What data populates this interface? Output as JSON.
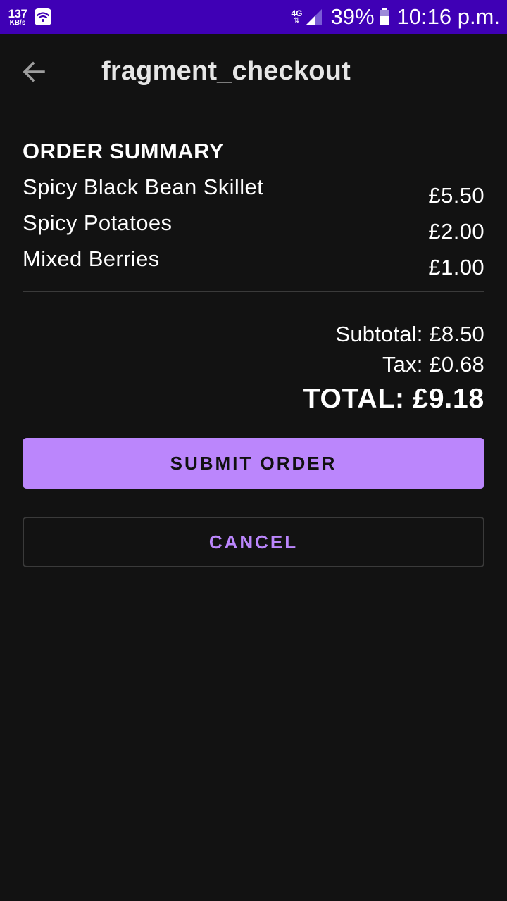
{
  "status_bar": {
    "net_speed_value": "137",
    "net_speed_unit": "KB/s",
    "network_type": "4G",
    "network_arrows": "⇅",
    "battery_percent": "39%",
    "time": "10:16 p.m.",
    "icons": [
      "wifi-icon",
      "signal-icon",
      "battery-icon"
    ]
  },
  "app_bar": {
    "title": "fragment_checkout",
    "back_icon": "arrow-left-icon"
  },
  "order_summary": {
    "heading": "ORDER SUMMARY",
    "items": [
      {
        "name": "Spicy Black Bean Skillet",
        "price": "£5.50"
      },
      {
        "name": "Spicy Potatoes",
        "price": "£2.00"
      },
      {
        "name": "Mixed Berries",
        "price": "£1.00"
      }
    ],
    "subtotal": "Subtotal: £8.50",
    "tax": "Tax: £0.68",
    "total": "TOTAL: £9.18"
  },
  "actions": {
    "submit_label": "SUBMIT ORDER",
    "cancel_label": "CANCEL"
  },
  "colors": {
    "status_bar": "#3f00b5",
    "background": "#121212",
    "accent": "#bb86fc",
    "divider": "#3a3a3a"
  }
}
